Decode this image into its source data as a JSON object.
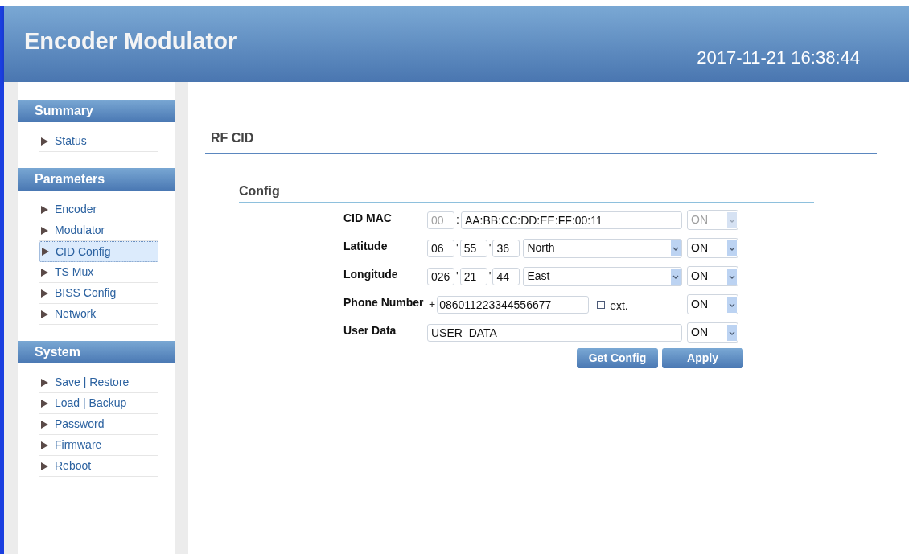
{
  "header": {
    "title": "Encoder Modulator",
    "datetime": "2017-11-21 16:38:44"
  },
  "sidebar": [
    {
      "title": "Summary",
      "items": [
        {
          "label": "Status",
          "selected": false
        }
      ]
    },
    {
      "title": "Parameters",
      "items": [
        {
          "label": "Encoder",
          "selected": false
        },
        {
          "label": "Modulator",
          "selected": false
        },
        {
          "label": "CID Config",
          "selected": true
        },
        {
          "label": "TS Mux",
          "selected": false
        },
        {
          "label": "BISS Config",
          "selected": false
        },
        {
          "label": "Network",
          "selected": false
        }
      ]
    },
    {
      "title": "System",
      "items": [
        {
          "label": "Save | Restore",
          "selected": false
        },
        {
          "label": "Load | Backup",
          "selected": false
        },
        {
          "label": "Password",
          "selected": false
        },
        {
          "label": "Firmware",
          "selected": false
        },
        {
          "label": "Reboot",
          "selected": false
        }
      ]
    }
  ],
  "page_title": "RF CID",
  "section_title": "Config",
  "rows": [
    {
      "label": "CID MAC",
      "fields": [
        {
          "kind": "code",
          "value": "00",
          "disabled": true
        },
        {
          "kind": "sep",
          "text": ":"
        },
        {
          "kind": "text",
          "value": "AA:BB:CC:DD:EE:FF:00:11",
          "disabled": false
        }
      ],
      "toggle": {
        "value": "ON",
        "disabled": true
      }
    },
    {
      "label": "Latitude",
      "fields": [
        {
          "kind": "code",
          "value": "06",
          "disabled": false
        },
        {
          "kind": "sep",
          "text": "'"
        },
        {
          "kind": "code",
          "value": "55",
          "disabled": false
        },
        {
          "kind": "sep",
          "text": "'"
        },
        {
          "kind": "code",
          "value": "36",
          "disabled": false
        },
        {
          "kind": "dropdown",
          "value": "North"
        }
      ],
      "toggle": {
        "value": "ON",
        "disabled": false
      }
    },
    {
      "label": "Longitude",
      "fields": [
        {
          "kind": "code",
          "value": "026",
          "disabled": false
        },
        {
          "kind": "sep",
          "text": "'"
        },
        {
          "kind": "code",
          "value": "21",
          "disabled": false
        },
        {
          "kind": "sep",
          "text": "'"
        },
        {
          "kind": "code",
          "value": "44",
          "disabled": false
        },
        {
          "kind": "dropdown",
          "value": "East"
        }
      ],
      "toggle": {
        "value": "ON",
        "disabled": false
      }
    },
    {
      "label": "Phone Number",
      "fields": [
        {
          "kind": "sep",
          "text": "+"
        },
        {
          "kind": "phone",
          "value": "086011223344556677",
          "disabled": false
        },
        {
          "kind": "check",
          "label": "ext.",
          "checked": false
        }
      ],
      "toggle": {
        "value": "ON",
        "disabled": false
      }
    },
    {
      "label": "User Data",
      "fields": [
        {
          "kind": "text",
          "value": "USER_DATA",
          "disabled": false
        }
      ],
      "toggle": {
        "value": "ON",
        "disabled": false
      }
    }
  ],
  "buttons": [
    "Get Config",
    "Apply"
  ]
}
